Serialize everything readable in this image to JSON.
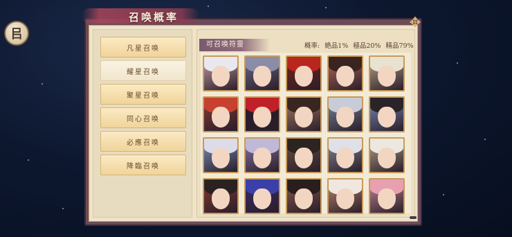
{
  "header": {
    "title": "召唤概率"
  },
  "back_button": {
    "label": "㠯"
  },
  "sidebar": {
    "items": [
      {
        "label": "凡星召唤",
        "active": false
      },
      {
        "label": "耀星召唤",
        "active": true
      },
      {
        "label": "聚星召唤",
        "active": false
      },
      {
        "label": "同心召唤",
        "active": false
      },
      {
        "label": "必應召唤",
        "active": false
      },
      {
        "label": "降臨召唤",
        "active": false
      }
    ]
  },
  "pool": {
    "label": "可召唤符靈",
    "rates_label": "概率:",
    "rates": [
      {
        "text": "絶品1%"
      },
      {
        "text": "極品20%"
      },
      {
        "text": "精品79%"
      }
    ]
  },
  "characters": [
    {
      "name": "portrait-1",
      "hair": "#e8e8ee",
      "bg": "#c9a0a8"
    },
    {
      "name": "portrait-2",
      "hair": "#8a8ca8",
      "bg": "#6a6a88"
    },
    {
      "name": "portrait-3",
      "hair": "#b8261e",
      "bg": "#7a2418"
    },
    {
      "name": "portrait-4",
      "hair": "#3a2420",
      "bg": "#b86a5a"
    },
    {
      "name": "portrait-5",
      "hair": "#e8e2d0",
      "bg": "#bda68a"
    },
    {
      "name": "portrait-6",
      "hair": "#c84030",
      "bg": "#8a3a34"
    },
    {
      "name": "portrait-7",
      "hair": "#c02028",
      "bg": "#2a1c28"
    },
    {
      "name": "portrait-8",
      "hair": "#3a2620",
      "bg": "#a87c64"
    },
    {
      "name": "portrait-9",
      "hair": "#c8ccd8",
      "bg": "#7a8aa0"
    },
    {
      "name": "portrait-10",
      "hair": "#2a2428",
      "bg": "#7a8cb8"
    },
    {
      "name": "portrait-11",
      "hair": "#dcdce8",
      "bg": "#7d93c0"
    },
    {
      "name": "portrait-12",
      "hair": "#c0b8d8",
      "bg": "#8a7aa8"
    },
    {
      "name": "portrait-13",
      "hair": "#2c2420",
      "bg": "#6a5040"
    },
    {
      "name": "portrait-14",
      "hair": "#e0e0e8",
      "bg": "#8a8a98"
    },
    {
      "name": "portrait-15",
      "hair": "#ece8e0",
      "bg": "#b8a48a"
    },
    {
      "name": "portrait-16",
      "hair": "#2a2220",
      "bg": "#8a3a30"
    },
    {
      "name": "portrait-17",
      "hair": "#3a40a8",
      "bg": "#3a2a6a"
    },
    {
      "name": "portrait-18",
      "hair": "#2a1e1c",
      "bg": "#8a5a4a"
    },
    {
      "name": "portrait-19",
      "hair": "#f0e8e0",
      "bg": "#c08a70"
    },
    {
      "name": "portrait-20",
      "hair": "#e8a0b0",
      "bg": "#c88a98"
    }
  ],
  "colors": {
    "frame": "#6b4a5a",
    "gold": "#c9a45c",
    "panel": "#efe3c8",
    "button": "#f0d49a",
    "text": "#6a4a2c"
  }
}
